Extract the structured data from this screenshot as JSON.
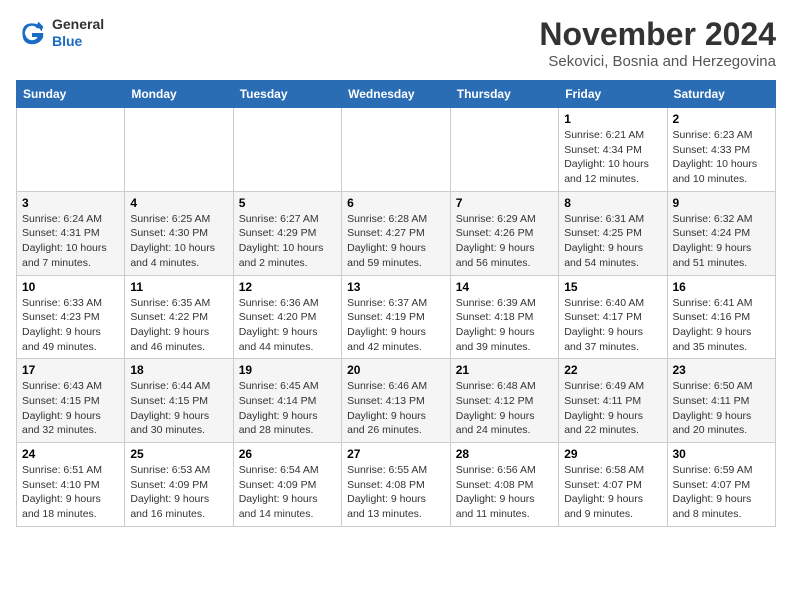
{
  "header": {
    "logo_general": "General",
    "logo_blue": "Blue",
    "month_title": "November 2024",
    "location": "Sekovici, Bosnia and Herzegovina"
  },
  "days_of_week": [
    "Sunday",
    "Monday",
    "Tuesday",
    "Wednesday",
    "Thursday",
    "Friday",
    "Saturday"
  ],
  "weeks": [
    [
      {
        "day": "",
        "info": ""
      },
      {
        "day": "",
        "info": ""
      },
      {
        "day": "",
        "info": ""
      },
      {
        "day": "",
        "info": ""
      },
      {
        "day": "",
        "info": ""
      },
      {
        "day": "1",
        "info": "Sunrise: 6:21 AM\nSunset: 4:34 PM\nDaylight: 10 hours and 12 minutes."
      },
      {
        "day": "2",
        "info": "Sunrise: 6:23 AM\nSunset: 4:33 PM\nDaylight: 10 hours and 10 minutes."
      }
    ],
    [
      {
        "day": "3",
        "info": "Sunrise: 6:24 AM\nSunset: 4:31 PM\nDaylight: 10 hours and 7 minutes."
      },
      {
        "day": "4",
        "info": "Sunrise: 6:25 AM\nSunset: 4:30 PM\nDaylight: 10 hours and 4 minutes."
      },
      {
        "day": "5",
        "info": "Sunrise: 6:27 AM\nSunset: 4:29 PM\nDaylight: 10 hours and 2 minutes."
      },
      {
        "day": "6",
        "info": "Sunrise: 6:28 AM\nSunset: 4:27 PM\nDaylight: 9 hours and 59 minutes."
      },
      {
        "day": "7",
        "info": "Sunrise: 6:29 AM\nSunset: 4:26 PM\nDaylight: 9 hours and 56 minutes."
      },
      {
        "day": "8",
        "info": "Sunrise: 6:31 AM\nSunset: 4:25 PM\nDaylight: 9 hours and 54 minutes."
      },
      {
        "day": "9",
        "info": "Sunrise: 6:32 AM\nSunset: 4:24 PM\nDaylight: 9 hours and 51 minutes."
      }
    ],
    [
      {
        "day": "10",
        "info": "Sunrise: 6:33 AM\nSunset: 4:23 PM\nDaylight: 9 hours and 49 minutes."
      },
      {
        "day": "11",
        "info": "Sunrise: 6:35 AM\nSunset: 4:22 PM\nDaylight: 9 hours and 46 minutes."
      },
      {
        "day": "12",
        "info": "Sunrise: 6:36 AM\nSunset: 4:20 PM\nDaylight: 9 hours and 44 minutes."
      },
      {
        "day": "13",
        "info": "Sunrise: 6:37 AM\nSunset: 4:19 PM\nDaylight: 9 hours and 42 minutes."
      },
      {
        "day": "14",
        "info": "Sunrise: 6:39 AM\nSunset: 4:18 PM\nDaylight: 9 hours and 39 minutes."
      },
      {
        "day": "15",
        "info": "Sunrise: 6:40 AM\nSunset: 4:17 PM\nDaylight: 9 hours and 37 minutes."
      },
      {
        "day": "16",
        "info": "Sunrise: 6:41 AM\nSunset: 4:16 PM\nDaylight: 9 hours and 35 minutes."
      }
    ],
    [
      {
        "day": "17",
        "info": "Sunrise: 6:43 AM\nSunset: 4:15 PM\nDaylight: 9 hours and 32 minutes."
      },
      {
        "day": "18",
        "info": "Sunrise: 6:44 AM\nSunset: 4:15 PM\nDaylight: 9 hours and 30 minutes."
      },
      {
        "day": "19",
        "info": "Sunrise: 6:45 AM\nSunset: 4:14 PM\nDaylight: 9 hours and 28 minutes."
      },
      {
        "day": "20",
        "info": "Sunrise: 6:46 AM\nSunset: 4:13 PM\nDaylight: 9 hours and 26 minutes."
      },
      {
        "day": "21",
        "info": "Sunrise: 6:48 AM\nSunset: 4:12 PM\nDaylight: 9 hours and 24 minutes."
      },
      {
        "day": "22",
        "info": "Sunrise: 6:49 AM\nSunset: 4:11 PM\nDaylight: 9 hours and 22 minutes."
      },
      {
        "day": "23",
        "info": "Sunrise: 6:50 AM\nSunset: 4:11 PM\nDaylight: 9 hours and 20 minutes."
      }
    ],
    [
      {
        "day": "24",
        "info": "Sunrise: 6:51 AM\nSunset: 4:10 PM\nDaylight: 9 hours and 18 minutes."
      },
      {
        "day": "25",
        "info": "Sunrise: 6:53 AM\nSunset: 4:09 PM\nDaylight: 9 hours and 16 minutes."
      },
      {
        "day": "26",
        "info": "Sunrise: 6:54 AM\nSunset: 4:09 PM\nDaylight: 9 hours and 14 minutes."
      },
      {
        "day": "27",
        "info": "Sunrise: 6:55 AM\nSunset: 4:08 PM\nDaylight: 9 hours and 13 minutes."
      },
      {
        "day": "28",
        "info": "Sunrise: 6:56 AM\nSunset: 4:08 PM\nDaylight: 9 hours and 11 minutes."
      },
      {
        "day": "29",
        "info": "Sunrise: 6:58 AM\nSunset: 4:07 PM\nDaylight: 9 hours and 9 minutes."
      },
      {
        "day": "30",
        "info": "Sunrise: 6:59 AM\nSunset: 4:07 PM\nDaylight: 9 hours and 8 minutes."
      }
    ]
  ]
}
